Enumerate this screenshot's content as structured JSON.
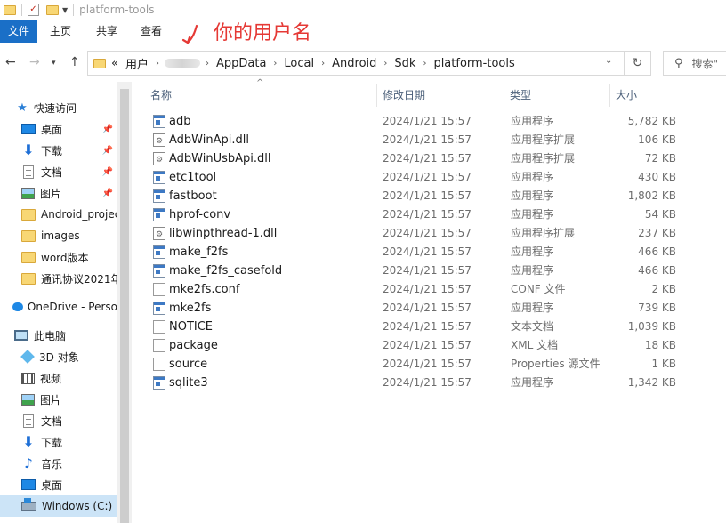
{
  "window": {
    "title": "platform-tools"
  },
  "ribbon": {
    "tabs": [
      "文件",
      "主页",
      "共享",
      "查看"
    ]
  },
  "annotation": {
    "text": "你的用户名",
    "color": "#e53935"
  },
  "address": {
    "prefix": "«",
    "crumbs": [
      "用户",
      "AppData",
      "Local",
      "Android",
      "Sdk",
      "platform-tools"
    ]
  },
  "search": {
    "placeholder": "搜索\""
  },
  "sidebar": {
    "items": [
      {
        "label": "快速访问",
        "icon": "star-icon",
        "pinned": false
      },
      {
        "label": "桌面",
        "icon": "desktop-icon",
        "pinned": true
      },
      {
        "label": "下载",
        "icon": "download-icon",
        "pinned": true
      },
      {
        "label": "文档",
        "icon": "document-icon",
        "pinned": true
      },
      {
        "label": "图片",
        "icon": "picture-icon",
        "pinned": true
      },
      {
        "label": "Android_projec",
        "icon": "folder-icon",
        "pinned": false
      },
      {
        "label": "images",
        "icon": "folder-icon",
        "pinned": false
      },
      {
        "label": "word版本",
        "icon": "folder-icon",
        "pinned": false
      },
      {
        "label": "通讯协议2021年",
        "icon": "folder-icon",
        "pinned": false
      },
      {
        "label": "OneDrive - Perso",
        "icon": "cloud-icon",
        "pinned": false
      },
      {
        "label": "此电脑",
        "icon": "computer-icon",
        "pinned": false
      },
      {
        "label": "3D 对象",
        "icon": "3d-objects-icon",
        "pinned": false
      },
      {
        "label": "视频",
        "icon": "video-icon",
        "pinned": false
      },
      {
        "label": "图片",
        "icon": "picture-icon",
        "pinned": false
      },
      {
        "label": "文档",
        "icon": "document-icon",
        "pinned": false
      },
      {
        "label": "下载",
        "icon": "download-icon",
        "pinned": false
      },
      {
        "label": "音乐",
        "icon": "music-icon",
        "pinned": false
      },
      {
        "label": "桌面",
        "icon": "desktop-icon",
        "pinned": false
      },
      {
        "label": "Windows (C:)",
        "icon": "drive-icon",
        "pinned": false,
        "selected": true
      }
    ]
  },
  "columns": {
    "name": "名称",
    "date": "修改日期",
    "type": "类型",
    "size": "大小"
  },
  "files": [
    {
      "name": "adb",
      "date": "2024/1/21 15:57",
      "type": "应用程序",
      "size": "5,782 KB",
      "icon": "exe"
    },
    {
      "name": "AdbWinApi.dll",
      "date": "2024/1/21 15:57",
      "type": "应用程序扩展",
      "size": "106 KB",
      "icon": "dll"
    },
    {
      "name": "AdbWinUsbApi.dll",
      "date": "2024/1/21 15:57",
      "type": "应用程序扩展",
      "size": "72 KB",
      "icon": "dll"
    },
    {
      "name": "etc1tool",
      "date": "2024/1/21 15:57",
      "type": "应用程序",
      "size": "430 KB",
      "icon": "exe"
    },
    {
      "name": "fastboot",
      "date": "2024/1/21 15:57",
      "type": "应用程序",
      "size": "1,802 KB",
      "icon": "exe"
    },
    {
      "name": "hprof-conv",
      "date": "2024/1/21 15:57",
      "type": "应用程序",
      "size": "54 KB",
      "icon": "exe"
    },
    {
      "name": "libwinpthread-1.dll",
      "date": "2024/1/21 15:57",
      "type": "应用程序扩展",
      "size": "237 KB",
      "icon": "dll"
    },
    {
      "name": "make_f2fs",
      "date": "2024/1/21 15:57",
      "type": "应用程序",
      "size": "466 KB",
      "icon": "exe"
    },
    {
      "name": "make_f2fs_casefold",
      "date": "2024/1/21 15:57",
      "type": "应用程序",
      "size": "466 KB",
      "icon": "exe"
    },
    {
      "name": "mke2fs.conf",
      "date": "2024/1/21 15:57",
      "type": "CONF 文件",
      "size": "2 KB",
      "icon": "txt"
    },
    {
      "name": "mke2fs",
      "date": "2024/1/21 15:57",
      "type": "应用程序",
      "size": "739 KB",
      "icon": "exe"
    },
    {
      "name": "NOTICE",
      "date": "2024/1/21 15:57",
      "type": "文本文档",
      "size": "1,039 KB",
      "icon": "txt"
    },
    {
      "name": "package",
      "date": "2024/1/21 15:57",
      "type": "XML 文档",
      "size": "18 KB",
      "icon": "txt"
    },
    {
      "name": "source",
      "date": "2024/1/21 15:57",
      "type": "Properties 源文件",
      "size": "1 KB",
      "icon": "txt"
    },
    {
      "name": "sqlite3",
      "date": "2024/1/21 15:57",
      "type": "应用程序",
      "size": "1,342 KB",
      "icon": "exe"
    }
  ]
}
